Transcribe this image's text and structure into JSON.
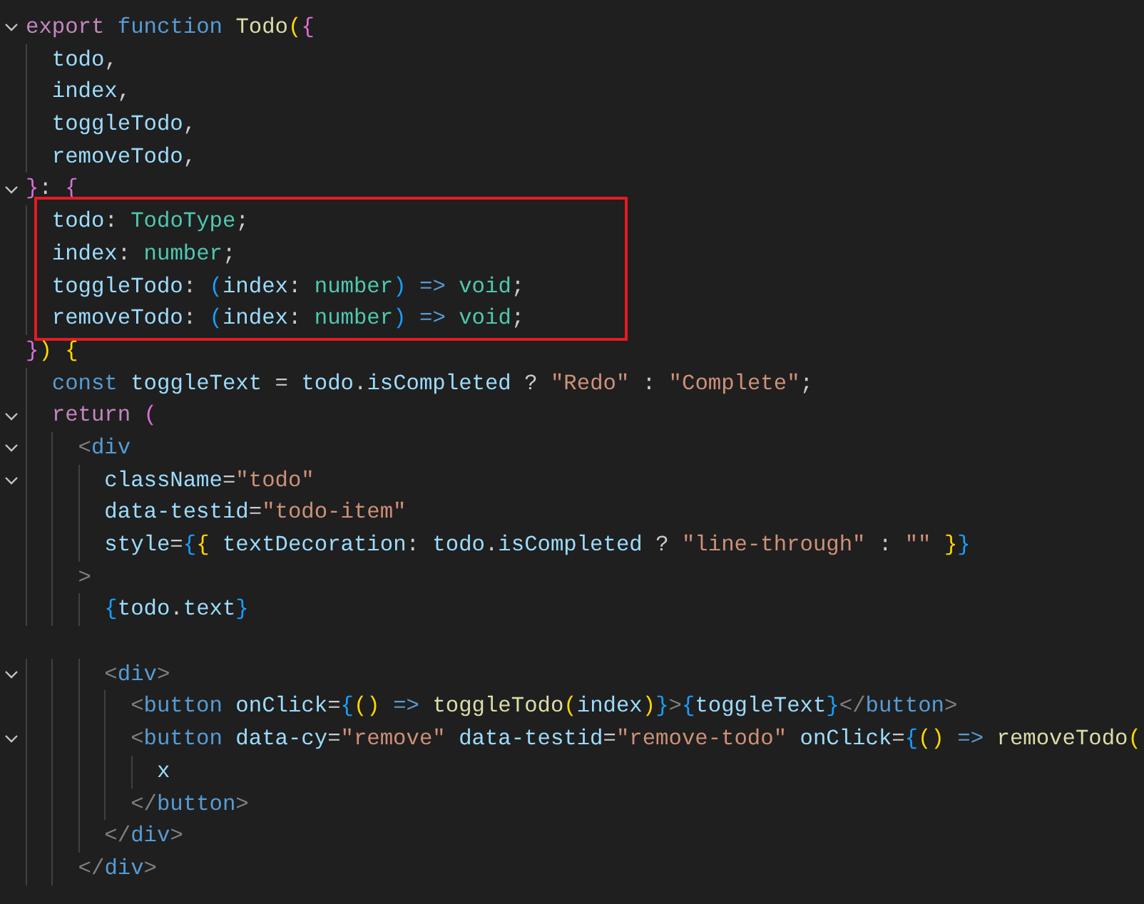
{
  "editor": {
    "lines": [
      {
        "fold": true,
        "highlighted": false,
        "text": "export function Todo({"
      },
      {
        "fold": false,
        "highlighted": false,
        "text": "  todo,"
      },
      {
        "fold": false,
        "highlighted": false,
        "text": "  index,"
      },
      {
        "fold": false,
        "highlighted": false,
        "text": "  toggleTodo,"
      },
      {
        "fold": false,
        "highlighted": false,
        "text": "  removeTodo,"
      },
      {
        "fold": true,
        "highlighted": false,
        "text": "}: {"
      },
      {
        "fold": false,
        "highlighted": true,
        "text": "  todo: TodoType;"
      },
      {
        "fold": false,
        "highlighted": true,
        "text": "  index: number;"
      },
      {
        "fold": false,
        "highlighted": true,
        "text": "  toggleTodo: (index: number) => void;"
      },
      {
        "fold": false,
        "highlighted": true,
        "text": "  removeTodo: (index: number) => void;"
      },
      {
        "fold": false,
        "highlighted": false,
        "text": "}) {"
      },
      {
        "fold": false,
        "highlighted": false,
        "text": "  const toggleText = todo.isCompleted ? \"Redo\" : \"Complete\";"
      },
      {
        "fold": true,
        "highlighted": false,
        "text": "  return ("
      },
      {
        "fold": true,
        "highlighted": false,
        "text": "    <div"
      },
      {
        "fold": true,
        "highlighted": false,
        "text": "      className=\"todo\""
      },
      {
        "fold": false,
        "highlighted": false,
        "text": "      data-testid=\"todo-item\""
      },
      {
        "fold": false,
        "highlighted": false,
        "text": "      style={{ textDecoration: todo.isCompleted ? \"line-through\" : \"\" }}"
      },
      {
        "fold": false,
        "highlighted": false,
        "text": "    >"
      },
      {
        "fold": false,
        "highlighted": false,
        "text": "      {todo.text}"
      },
      {
        "fold": false,
        "highlighted": false
      },
      {
        "fold": true,
        "highlighted": false,
        "text": "      <div>"
      },
      {
        "fold": false,
        "highlighted": false,
        "text": "        <button onClick={() => toggleTodo(index)}>{toggleText}</button>"
      },
      {
        "fold": true,
        "highlighted": false,
        "text": "        <button data-cy=\"remove\" data-testid=\"remove-todo\" onClick={() => removeTodo("
      },
      {
        "fold": false,
        "highlighted": false,
        "text": "          x"
      },
      {
        "fold": false,
        "highlighted": false,
        "text": "        </button>"
      },
      {
        "fold": false,
        "highlighted": false,
        "text": "      </div>"
      },
      {
        "fold": false,
        "highlighted": false,
        "text": "    </div>"
      }
    ]
  }
}
